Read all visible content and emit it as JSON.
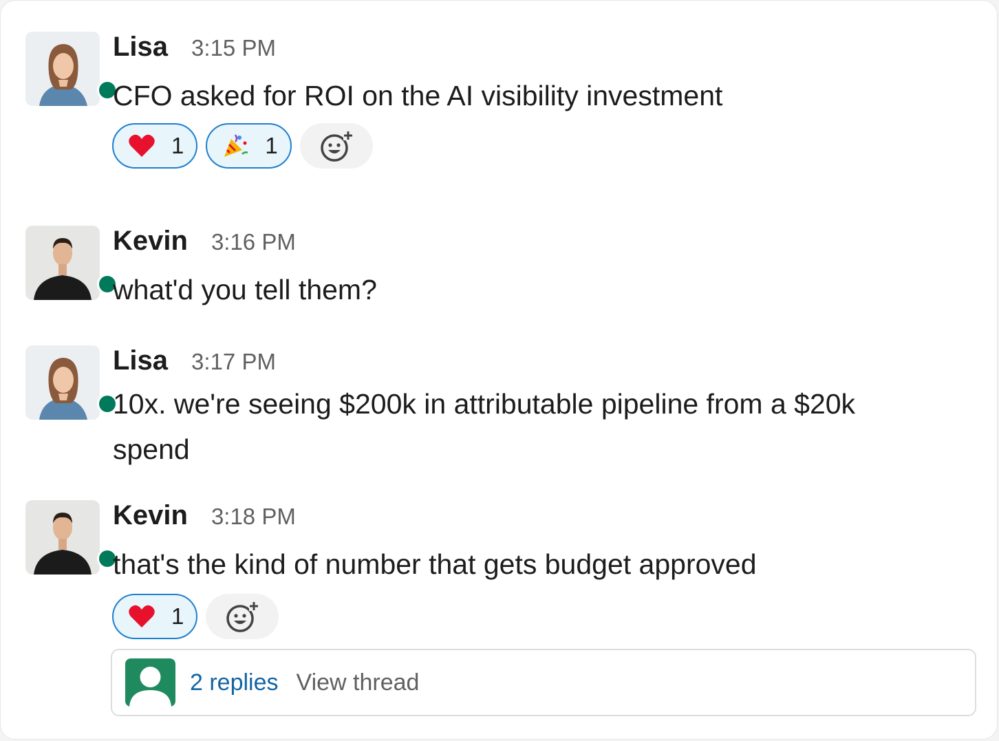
{
  "colors": {
    "presence": "#007a5a",
    "reaction_border": "#1d7fd0",
    "reaction_bg": "#e8f5fa",
    "link": "#1264a3",
    "thread_avatar_bg": "#1e8a5e"
  },
  "messages": [
    {
      "author": "Lisa",
      "time": "3:15 PM",
      "lines": [
        "CFO asked for ROI on the AI visibility investment"
      ],
      "reactions": [
        {
          "emoji": "heart-icon",
          "count": "1"
        },
        {
          "emoji": "party-popper-icon",
          "count": "1"
        }
      ],
      "add_reaction_icon": "add-reaction-icon"
    },
    {
      "author": "Kevin",
      "time": "3:16 PM",
      "lines": [
        "what'd you tell them?"
      ]
    },
    {
      "author": "Lisa",
      "time": "3:17 PM",
      "lines": [
        "10x. we're seeing $200k in attributable pipeline from a $20k",
        "spend"
      ]
    },
    {
      "author": "Kevin",
      "time": "3:18 PM",
      "lines": [
        "that's the kind of number that gets budget approved"
      ],
      "reactions": [
        {
          "emoji": "heart-icon",
          "count": "1"
        }
      ],
      "add_reaction_icon": "add-reaction-icon",
      "thread": {
        "replies": "2 replies",
        "view": "View thread"
      }
    }
  ]
}
